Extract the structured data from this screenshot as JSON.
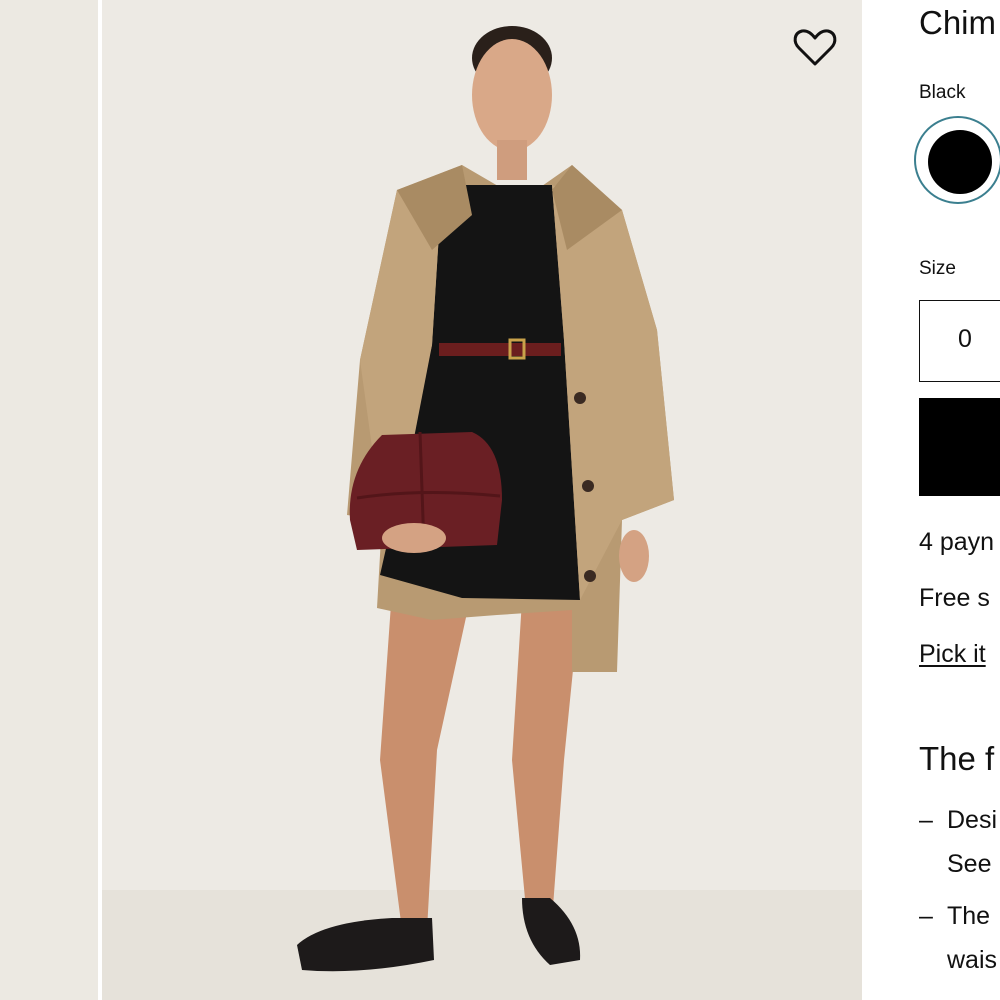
{
  "gallery": {
    "thumbnail_alt": "",
    "main_image_alt": "",
    "favorite_icon": "heart-outline-icon"
  },
  "product": {
    "title": "Chim",
    "color_label": "Black",
    "swatch_color": "#000000",
    "size_label": "Size",
    "size_options": [
      "0"
    ],
    "payments_text": "4 payn",
    "shipping_text": "Free s",
    "pickup_link": "Pick it"
  },
  "details": {
    "heading": "The f",
    "bullets": [
      {
        "dash": "–",
        "lines": [
          "Desi",
          "See"
        ]
      },
      {
        "dash": "–",
        "lines": [
          "The",
          "wais"
        ]
      }
    ]
  }
}
